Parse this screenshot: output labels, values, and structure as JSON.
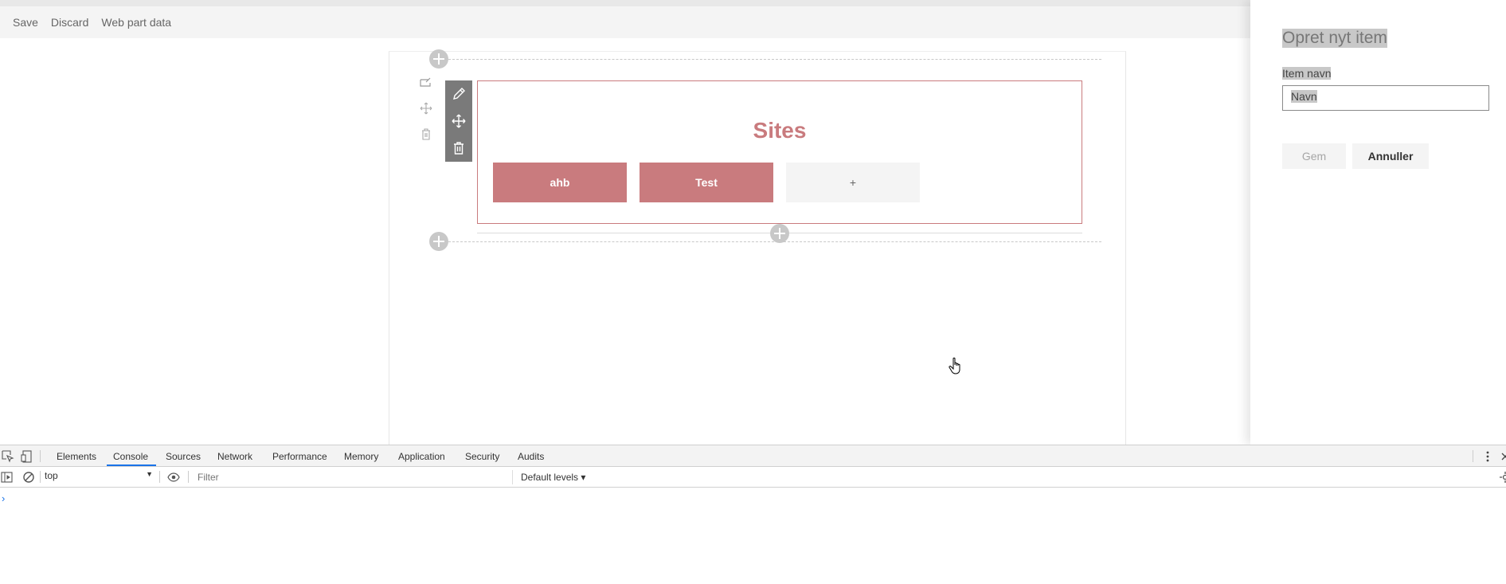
{
  "command_bar": {
    "save": "Save",
    "discard": "Discard",
    "web_part_data": "Web part data"
  },
  "webpart": {
    "title": "Sites",
    "tiles": [
      "ahb",
      "Test"
    ],
    "add_tile": "+"
  },
  "panel": {
    "title": "Opret nyt item",
    "field_label": "Item navn",
    "field_value": "Navn",
    "save_button": "Gem",
    "cancel_button": "Annuller"
  },
  "devtools": {
    "tabs": [
      "Elements",
      "Console",
      "Sources",
      "Network",
      "Performance",
      "Memory",
      "Application",
      "Security",
      "Audits"
    ],
    "active_tab": "Console",
    "context": "top",
    "filter_placeholder": "Filter",
    "levels": "Default levels ▾",
    "prompt": "›"
  },
  "colors": {
    "accent": "#c97b7e",
    "toolbar": "#7a7a7a",
    "devtools_active": "#1a73e8"
  }
}
